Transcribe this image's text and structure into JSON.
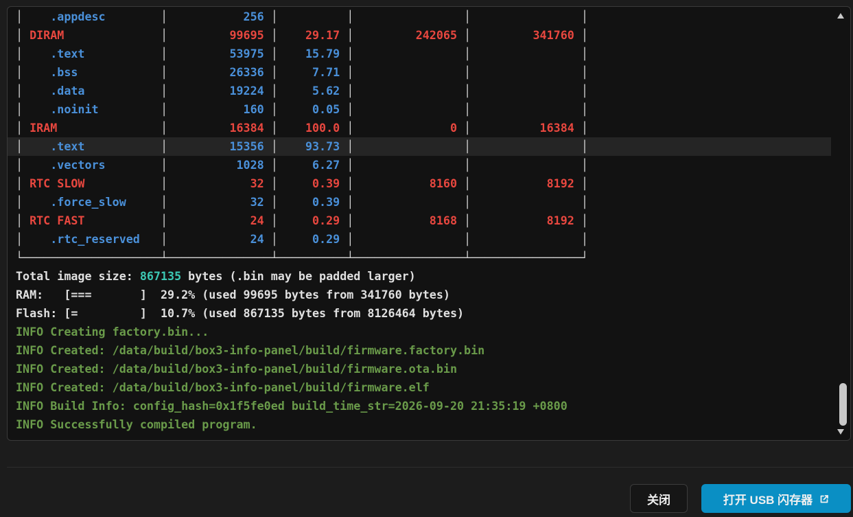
{
  "terminal": {
    "lines": [
      [
        {
          "t": "│",
          "c": "border"
        },
        {
          "t": "    .appdesc        ",
          "c": "blue"
        },
        {
          "t": "│",
          "c": "border"
        },
        {
          "t": "           256 ",
          "c": "blue"
        },
        {
          "t": "│",
          "c": "border"
        },
        {
          "t": "          ",
          "c": "blue"
        },
        {
          "t": "│",
          "c": "border"
        },
        {
          "t": "                ",
          "c": "blue"
        },
        {
          "t": "│",
          "c": "border"
        },
        {
          "t": "                ",
          "c": "blue"
        },
        {
          "t": "│",
          "c": "border"
        }
      ],
      [
        {
          "t": "│",
          "c": "border"
        },
        {
          "t": " DIRAM              ",
          "c": "red"
        },
        {
          "t": "│",
          "c": "border"
        },
        {
          "t": "         99695 ",
          "c": "red"
        },
        {
          "t": "│",
          "c": "border"
        },
        {
          "t": "    29.17 ",
          "c": "red"
        },
        {
          "t": "│",
          "c": "border"
        },
        {
          "t": "         242065 ",
          "c": "red"
        },
        {
          "t": "│",
          "c": "border"
        },
        {
          "t": "         341760 ",
          "c": "red"
        },
        {
          "t": "│",
          "c": "border"
        }
      ],
      [
        {
          "t": "│",
          "c": "border"
        },
        {
          "t": "    .text           ",
          "c": "blue"
        },
        {
          "t": "│",
          "c": "border"
        },
        {
          "t": "         53975 ",
          "c": "blue"
        },
        {
          "t": "│",
          "c": "border"
        },
        {
          "t": "    15.79 ",
          "c": "blue"
        },
        {
          "t": "│",
          "c": "border"
        },
        {
          "t": "                ",
          "c": "blue"
        },
        {
          "t": "│",
          "c": "border"
        },
        {
          "t": "                ",
          "c": "blue"
        },
        {
          "t": "│",
          "c": "border"
        }
      ],
      [
        {
          "t": "│",
          "c": "border"
        },
        {
          "t": "    .bss            ",
          "c": "blue"
        },
        {
          "t": "│",
          "c": "border"
        },
        {
          "t": "         26336 ",
          "c": "blue"
        },
        {
          "t": "│",
          "c": "border"
        },
        {
          "t": "     7.71 ",
          "c": "blue"
        },
        {
          "t": "│",
          "c": "border"
        },
        {
          "t": "                ",
          "c": "blue"
        },
        {
          "t": "│",
          "c": "border"
        },
        {
          "t": "                ",
          "c": "blue"
        },
        {
          "t": "│",
          "c": "border"
        }
      ],
      [
        {
          "t": "│",
          "c": "border"
        },
        {
          "t": "    .data           ",
          "c": "blue"
        },
        {
          "t": "│",
          "c": "border"
        },
        {
          "t": "         19224 ",
          "c": "blue"
        },
        {
          "t": "│",
          "c": "border"
        },
        {
          "t": "     5.62 ",
          "c": "blue"
        },
        {
          "t": "│",
          "c": "border"
        },
        {
          "t": "                ",
          "c": "blue"
        },
        {
          "t": "│",
          "c": "border"
        },
        {
          "t": "                ",
          "c": "blue"
        },
        {
          "t": "│",
          "c": "border"
        }
      ],
      [
        {
          "t": "│",
          "c": "border"
        },
        {
          "t": "    .noinit         ",
          "c": "blue"
        },
        {
          "t": "│",
          "c": "border"
        },
        {
          "t": "           160 ",
          "c": "blue"
        },
        {
          "t": "│",
          "c": "border"
        },
        {
          "t": "     0.05 ",
          "c": "blue"
        },
        {
          "t": "│",
          "c": "border"
        },
        {
          "t": "                ",
          "c": "blue"
        },
        {
          "t": "│",
          "c": "border"
        },
        {
          "t": "                ",
          "c": "blue"
        },
        {
          "t": "│",
          "c": "border"
        }
      ],
      [
        {
          "t": "│",
          "c": "border"
        },
        {
          "t": " IRAM               ",
          "c": "red"
        },
        {
          "t": "│",
          "c": "border"
        },
        {
          "t": "         16384 ",
          "c": "red"
        },
        {
          "t": "│",
          "c": "border"
        },
        {
          "t": "    100.0 ",
          "c": "red"
        },
        {
          "t": "│",
          "c": "border"
        },
        {
          "t": "              0 ",
          "c": "red"
        },
        {
          "t": "│",
          "c": "border"
        },
        {
          "t": "          16384 ",
          "c": "red"
        },
        {
          "t": "│",
          "c": "border"
        }
      ],
      [
        {
          "t": "│",
          "c": "border"
        },
        {
          "t": "    .text           ",
          "c": "blue"
        },
        {
          "t": "│",
          "c": "border"
        },
        {
          "t": "         15356 ",
          "c": "blue"
        },
        {
          "t": "│",
          "c": "border"
        },
        {
          "t": "    93.73 ",
          "c": "blue"
        },
        {
          "t": "│",
          "c": "border"
        },
        {
          "t": "                ",
          "c": "blue"
        },
        {
          "t": "│",
          "c": "border"
        },
        {
          "t": "                ",
          "c": "blue"
        },
        {
          "t": "│",
          "c": "border"
        }
      ],
      [
        {
          "t": "│",
          "c": "border"
        },
        {
          "t": "    .vectors        ",
          "c": "blue"
        },
        {
          "t": "│",
          "c": "border"
        },
        {
          "t": "          1028 ",
          "c": "blue"
        },
        {
          "t": "│",
          "c": "border"
        },
        {
          "t": "     6.27 ",
          "c": "blue"
        },
        {
          "t": "│",
          "c": "border"
        },
        {
          "t": "                ",
          "c": "blue"
        },
        {
          "t": "│",
          "c": "border"
        },
        {
          "t": "                ",
          "c": "blue"
        },
        {
          "t": "│",
          "c": "border"
        }
      ],
      [
        {
          "t": "│",
          "c": "border"
        },
        {
          "t": " RTC SLOW           ",
          "c": "red"
        },
        {
          "t": "│",
          "c": "border"
        },
        {
          "t": "            32 ",
          "c": "red"
        },
        {
          "t": "│",
          "c": "border"
        },
        {
          "t": "     0.39 ",
          "c": "red"
        },
        {
          "t": "│",
          "c": "border"
        },
        {
          "t": "           8160 ",
          "c": "red"
        },
        {
          "t": "│",
          "c": "border"
        },
        {
          "t": "           8192 ",
          "c": "red"
        },
        {
          "t": "│",
          "c": "border"
        }
      ],
      [
        {
          "t": "│",
          "c": "border"
        },
        {
          "t": "    .force_slow     ",
          "c": "blue"
        },
        {
          "t": "│",
          "c": "border"
        },
        {
          "t": "            32 ",
          "c": "blue"
        },
        {
          "t": "│",
          "c": "border"
        },
        {
          "t": "     0.39 ",
          "c": "blue"
        },
        {
          "t": "│",
          "c": "border"
        },
        {
          "t": "                ",
          "c": "blue"
        },
        {
          "t": "│",
          "c": "border"
        },
        {
          "t": "                ",
          "c": "blue"
        },
        {
          "t": "│",
          "c": "border"
        }
      ],
      [
        {
          "t": "│",
          "c": "border"
        },
        {
          "t": " RTC FAST           ",
          "c": "red"
        },
        {
          "t": "│",
          "c": "border"
        },
        {
          "t": "            24 ",
          "c": "red"
        },
        {
          "t": "│",
          "c": "border"
        },
        {
          "t": "     0.29 ",
          "c": "red"
        },
        {
          "t": "│",
          "c": "border"
        },
        {
          "t": "           8168 ",
          "c": "red"
        },
        {
          "t": "│",
          "c": "border"
        },
        {
          "t": "           8192 ",
          "c": "red"
        },
        {
          "t": "│",
          "c": "border"
        }
      ],
      [
        {
          "t": "│",
          "c": "border"
        },
        {
          "t": "    .rtc_reserved   ",
          "c": "blue"
        },
        {
          "t": "│",
          "c": "border"
        },
        {
          "t": "            24 ",
          "c": "blue"
        },
        {
          "t": "│",
          "c": "border"
        },
        {
          "t": "     0.29 ",
          "c": "blue"
        },
        {
          "t": "│",
          "c": "border"
        },
        {
          "t": "                ",
          "c": "blue"
        },
        {
          "t": "│",
          "c": "border"
        },
        {
          "t": "                ",
          "c": "blue"
        },
        {
          "t": "│",
          "c": "border"
        }
      ],
      [
        {
          "t": "└────────────────────┴───────────────┴──────────┴────────────────┴────────────────┘",
          "c": "border"
        }
      ],
      [
        {
          "t": "Total image size: ",
          "c": "white"
        },
        {
          "t": "867135",
          "c": "teal"
        },
        {
          "t": " bytes (.bin may be padded larger)",
          "c": "white"
        }
      ],
      [
        {
          "t": "RAM:   [===       ]  29.2% (used 99695 bytes from 341760 bytes)",
          "c": "white"
        }
      ],
      [
        {
          "t": "Flash: [=         ]  10.7% (used 867135 bytes from 8126464 bytes)",
          "c": "white"
        }
      ],
      [
        {
          "t": "INFO Creating factory.bin...",
          "c": "green"
        }
      ],
      [
        {
          "t": "INFO Created: /data/build/box3-info-panel/build/firmware.factory.bin",
          "c": "green"
        }
      ],
      [
        {
          "t": "INFO Created: /data/build/box3-info-panel/build/firmware.ota.bin",
          "c": "green"
        }
      ],
      [
        {
          "t": "INFO Created: /data/build/box3-info-panel/build/firmware.elf",
          "c": "green"
        }
      ],
      [
        {
          "t": "INFO Build Info: config_hash=0x1f5fe0ed build_time_str=2026-09-20 21:35:19 +0800",
          "c": "green"
        }
      ],
      [
        {
          "t": "INFO Successfully compiled program.",
          "c": "green"
        }
      ]
    ],
    "highlight_line": 7
  },
  "footer": {
    "close_label": "关闭",
    "open_usb_label": "打开 USB 闪存器",
    "open_usb_icon": "external-link-icon"
  },
  "colors": {
    "accent": "#0a8fc4",
    "red": "#e8473f",
    "blue": "#4a90d9",
    "green": "#6a9b4a",
    "teal": "#3cc8b4"
  }
}
